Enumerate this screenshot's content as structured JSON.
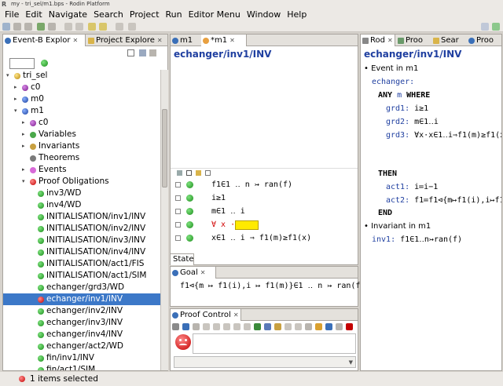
{
  "window": {
    "title": "my - tri_sel/m1.bps - Rodin Platform"
  },
  "menu": [
    "File",
    "Edit",
    "Navigate",
    "Search",
    "Project",
    "Run",
    "Editor Menu",
    "Window",
    "Help"
  ],
  "left_panel": {
    "tabs": [
      {
        "label": "Event-B Explor",
        "active": true
      },
      {
        "label": "Project Explore",
        "active": false
      }
    ],
    "tree": [
      {
        "label": "tri_sel",
        "indent": 0,
        "arrow": "▾",
        "icon": "project-icon"
      },
      {
        "label": "c0",
        "indent": 1,
        "arrow": "▸",
        "icon": "context-icon"
      },
      {
        "label": "m0",
        "indent": 1,
        "arrow": "▸",
        "icon": "machine-icon"
      },
      {
        "label": "m1",
        "indent": 1,
        "arrow": "▾",
        "icon": "machine-icon"
      },
      {
        "label": "c0",
        "indent": 2,
        "arrow": "▸",
        "icon": "context-icon"
      },
      {
        "label": "Variables",
        "indent": 2,
        "arrow": "▸",
        "icon": "variables-icon"
      },
      {
        "label": "Invariants",
        "indent": 2,
        "arrow": "▸",
        "icon": "invariants-icon"
      },
      {
        "label": "Theorems",
        "indent": 2,
        "arrow": "",
        "icon": "theorems-icon"
      },
      {
        "label": "Events",
        "indent": 2,
        "arrow": "▸",
        "icon": "events-icon"
      },
      {
        "label": "Proof Obligations",
        "indent": 2,
        "arrow": "▾",
        "icon": "po-red-icon"
      },
      {
        "label": "inv3/WD",
        "indent": 3,
        "arrow": "",
        "icon": "po-green-icon"
      },
      {
        "label": "inv4/WD",
        "indent": 3,
        "arrow": "",
        "icon": "po-green-icon"
      },
      {
        "label": "INITIALISATION/inv1/INV",
        "indent": 3,
        "arrow": "",
        "icon": "po-green-icon"
      },
      {
        "label": "INITIALISATION/inv2/INV",
        "indent": 3,
        "arrow": "",
        "icon": "po-green-icon"
      },
      {
        "label": "INITIALISATION/inv3/INV",
        "indent": 3,
        "arrow": "",
        "icon": "po-green-icon"
      },
      {
        "label": "INITIALISATION/inv4/INV",
        "indent": 3,
        "arrow": "",
        "icon": "po-green-icon"
      },
      {
        "label": "INITIALISATION/act1/FIS",
        "indent": 3,
        "arrow": "",
        "icon": "po-green-icon"
      },
      {
        "label": "INITIALISATION/act1/SIM",
        "indent": 3,
        "arrow": "",
        "icon": "po-green-icon"
      },
      {
        "label": "echanger/grd3/WD",
        "indent": 3,
        "arrow": "",
        "icon": "po-green-icon"
      },
      {
        "label": "echanger/inv1/INV",
        "indent": 3,
        "arrow": "",
        "icon": "po-red-icon",
        "selected": true
      },
      {
        "label": "echanger/inv2/INV",
        "indent": 3,
        "arrow": "",
        "icon": "po-green-icon"
      },
      {
        "label": "echanger/inv3/INV",
        "indent": 3,
        "arrow": "",
        "icon": "po-green-icon"
      },
      {
        "label": "echanger/inv4/INV",
        "indent": 3,
        "arrow": "",
        "icon": "po-green-icon"
      },
      {
        "label": "echanger/act2/WD",
        "indent": 3,
        "arrow": "",
        "icon": "po-green-icon"
      },
      {
        "label": "fin/inv1/INV",
        "indent": 3,
        "arrow": "",
        "icon": "po-green-icon"
      },
      {
        "label": "fin/act1/SIM",
        "indent": 3,
        "arrow": "",
        "icon": "po-green-icon"
      }
    ]
  },
  "editor": {
    "tabs": [
      {
        "label": "m1",
        "active": false
      },
      {
        "label": "*m1",
        "active": true
      }
    ],
    "title": "echanger/inv1/INV",
    "hypotheses": [
      {
        "text": "f1∈1 ‥ n ↣ ran(f)"
      },
      {
        "text": "i≥1"
      },
      {
        "text": "m∈1 ‥ i"
      },
      {
        "text": "∀ x ·",
        "quantifier": true
      },
      {
        "text": "x∈1 ‥ i ⇒ f1(m)≥f1(x)"
      }
    ],
    "state_tab": "State"
  },
  "goal": {
    "tab": "Goal",
    "text": "f1⊲{m ↦ f1(i),i ↦ f1(m)}∈1 ‥ n ↣ ran(f)"
  },
  "proof_control": {
    "tab": "Proof Control"
  },
  "right_panel": {
    "tabs": [
      {
        "label": "Rod",
        "active": true
      },
      {
        "label": "Proo",
        "active": false
      },
      {
        "label": "Sear",
        "active": false
      },
      {
        "label": "Proo",
        "active": false
      }
    ],
    "title": "echanger/inv1/INV",
    "event_header": "Event in m1",
    "event_name": "echanger:",
    "any_kw": "ANY",
    "any_var": "m",
    "where_kw": "WHERE",
    "guards": [
      {
        "label": "grd1:",
        "expr": "i≥1"
      },
      {
        "label": "grd2:",
        "expr": "m∈1‥i"
      },
      {
        "label": "grd3:",
        "expr": "∀x·x∈1‥i⇒f1(m)≥f1(x"
      }
    ],
    "then_kw": "THEN",
    "actions": [
      {
        "label": "act1:",
        "expr": "i≔i−1"
      },
      {
        "label": "act2:",
        "expr": "f1≔f1⊲{m↦f1(i),i↦f1("
      }
    ],
    "end_kw": "END",
    "invariant_header": "Invariant in m1",
    "invariant": {
      "label": "inv1:",
      "expr": "f1∈1‥n↣ran(f)"
    }
  },
  "status": {
    "text": "1 items selected"
  }
}
